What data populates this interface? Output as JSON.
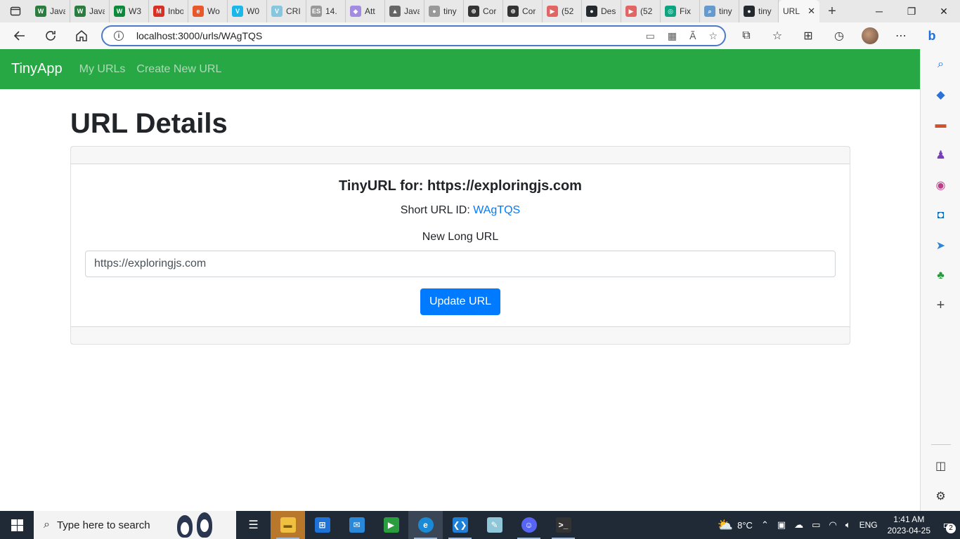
{
  "browser": {
    "tabs": [
      {
        "label": "Java",
        "favicon": "W",
        "color": "#2a7d3e"
      },
      {
        "label": "Java",
        "favicon": "W",
        "color": "#2a7d3e"
      },
      {
        "label": "W3",
        "favicon": "W",
        "color": "#0a8a3a"
      },
      {
        "label": "Inbox",
        "favicon": "M",
        "color": "#d93025"
      },
      {
        "label": "Wo",
        "favicon": "e",
        "color": "#e8582a"
      },
      {
        "label": "W0",
        "favicon": "V",
        "color": "#1ab7ea"
      },
      {
        "label": "CRI",
        "favicon": "V",
        "color": "#86c7df"
      },
      {
        "label": "14.",
        "favicon": "ES",
        "color": "#999999"
      },
      {
        "label": "Att",
        "favicon": "◆",
        "color": "#a28be0"
      },
      {
        "label": "Java",
        "favicon": "▲",
        "color": "#666666"
      },
      {
        "label": "tiny",
        "favicon": "●",
        "color": "#999999"
      },
      {
        "label": "Cor",
        "favicon": "⊕",
        "color": "#333333"
      },
      {
        "label": "Cor",
        "favicon": "⊕",
        "color": "#333333"
      },
      {
        "label": "(52",
        "favicon": "▶",
        "color": "#e06666"
      },
      {
        "label": "Des",
        "favicon": "●",
        "color": "#24292f"
      },
      {
        "label": "(52",
        "favicon": "▶",
        "color": "#e06666"
      },
      {
        "label": "Fix",
        "favicon": "◎",
        "color": "#10a37f"
      },
      {
        "label": "tiny",
        "favicon": "⌕",
        "color": "#6699cc"
      },
      {
        "label": "tiny",
        "favicon": "●",
        "color": "#24292f"
      }
    ],
    "active_tab_label": "URL",
    "active_tab_close": "✕",
    "address": "localhost:3000/urls/WAgTQS"
  },
  "navbar": {
    "brand": "TinyApp",
    "links": [
      "My URLs",
      "Create New URL"
    ],
    "bg_color": "#28a745"
  },
  "page": {
    "title": "URL Details",
    "card_title": "TinyURL for: https://exploringjs.com",
    "short_url_label": "Short URL ID: ",
    "short_url_id": "WAgTQS",
    "form_label": "New Long URL",
    "input_value": "https://exploringjs.com",
    "submit_label": "Update URL"
  },
  "taskbar": {
    "search_placeholder": "Type here to search",
    "weather": "8°C",
    "language": "ENG",
    "time": "1:41 AM",
    "date": "2023-04-25",
    "notifications": "2"
  }
}
